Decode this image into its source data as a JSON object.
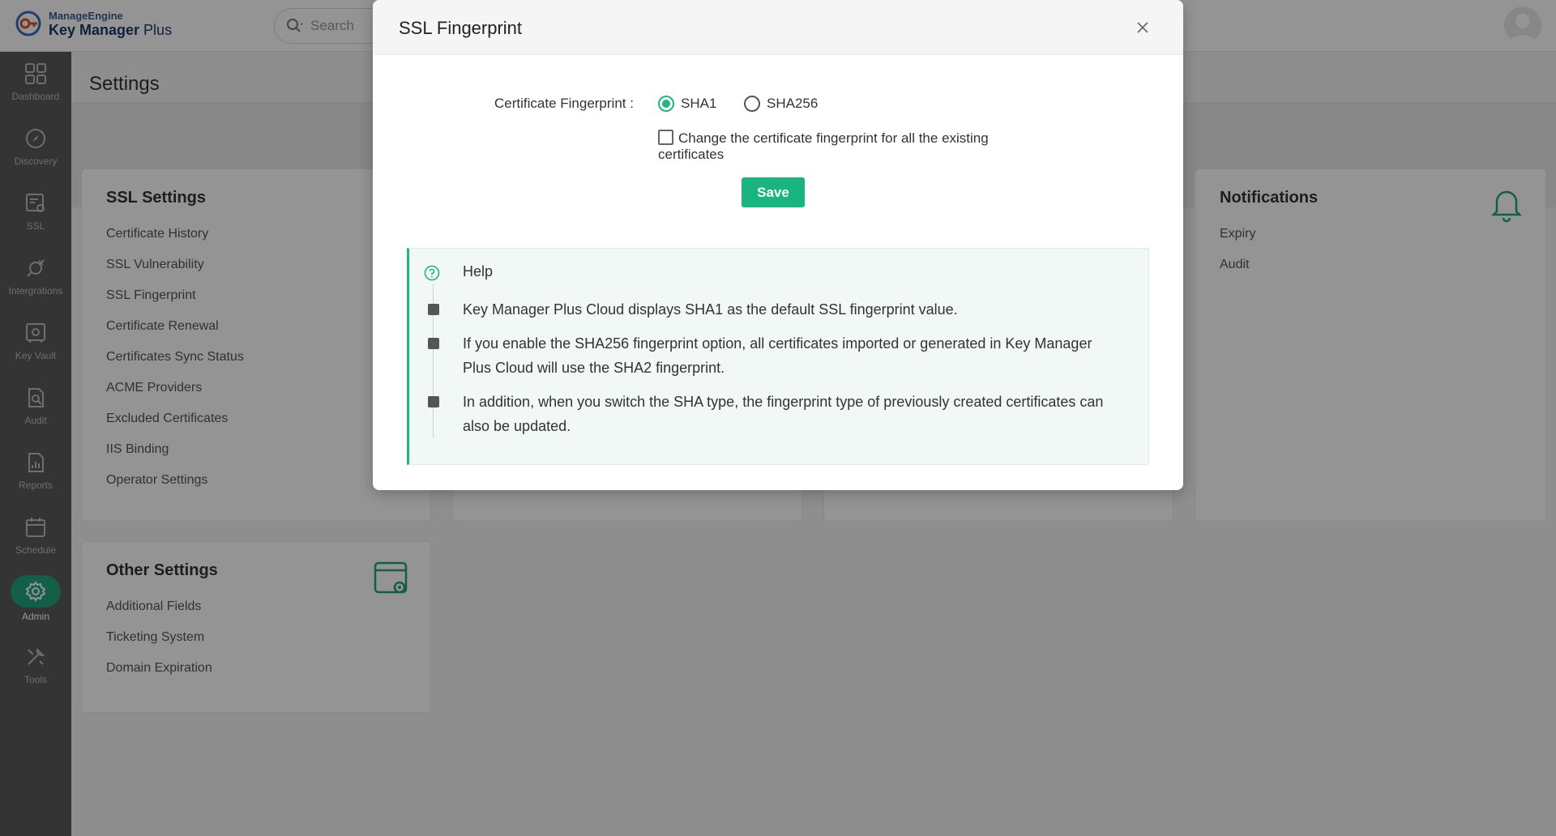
{
  "header": {
    "brand_small": "ManageEngine",
    "brand_big_bold": "Key Manager",
    "brand_big_rest": " Plus",
    "search_placeholder": "Search"
  },
  "sidebar": {
    "items": [
      {
        "label": "Dashboard",
        "icon": "dashboard-icon"
      },
      {
        "label": "Discovery",
        "icon": "compass-icon"
      },
      {
        "label": "SSL",
        "icon": "certificate-icon"
      },
      {
        "label": "Intergrations",
        "icon": "plug-icon"
      },
      {
        "label": "Key Vault",
        "icon": "vault-icon"
      },
      {
        "label": "Audit",
        "icon": "audit-icon"
      },
      {
        "label": "Reports",
        "icon": "report-icon"
      },
      {
        "label": "Schedule",
        "icon": "calendar-icon"
      },
      {
        "label": "Admin",
        "icon": "gear-icon",
        "active": true
      },
      {
        "label": "Tools",
        "icon": "tools-icon"
      }
    ]
  },
  "main": {
    "title": "Settings",
    "ssl_settings": {
      "title": "SSL Settings",
      "links": [
        "Certificate History",
        "SSL Vulnerability",
        "SSL Fingerprint",
        "Certificate Renewal",
        "Certificates Sync Status",
        "ACME Providers",
        "Excluded Certificates",
        "IIS Binding",
        "Operator Settings"
      ]
    },
    "notifications": {
      "title": "Notifications",
      "links": [
        "Expiry",
        "Audit"
      ]
    },
    "other_settings": {
      "title": "Other Settings",
      "links": [
        "Additional Fields",
        "Ticketing System",
        "Domain Expiration"
      ]
    }
  },
  "modal": {
    "title": "SSL Fingerprint",
    "field_label": "Certificate Fingerprint :",
    "options": [
      {
        "label": "SHA1",
        "checked": true
      },
      {
        "label": "SHA256",
        "checked": false
      }
    ],
    "checkbox_label": "Change the certificate fingerprint for all the existing certificates",
    "save_label": "Save",
    "help": {
      "title": "Help",
      "items": [
        "Key Manager Plus Cloud displays SHA1 as the default SSL fingerprint value.",
        "If you enable the SHA256 fingerprint option, all certificates imported or generated in Key Manager Plus Cloud will use the SHA2 fingerprint.",
        "In addition, when you switch the SHA type, the fingerprint type of previously created certificates can also be updated."
      ]
    }
  },
  "colors": {
    "accent": "#19b57f",
    "sidebar": "#5a5a5a"
  }
}
